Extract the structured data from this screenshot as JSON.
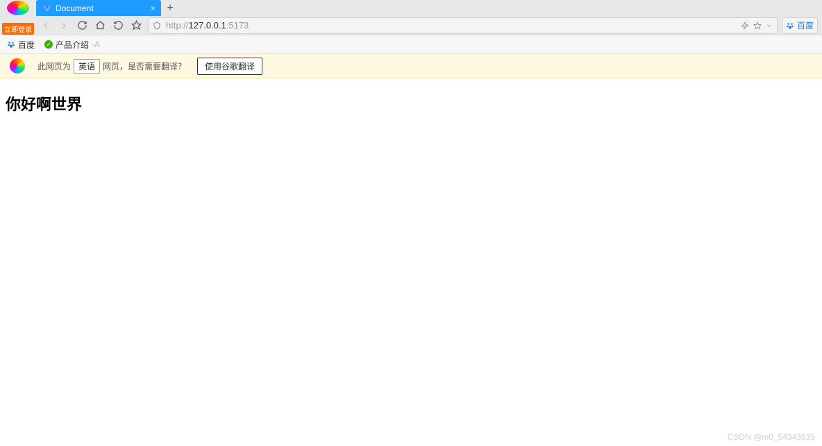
{
  "chrome": {
    "login_button": "立即登录",
    "tab": {
      "title": "Document",
      "close_glyph": "×"
    },
    "new_tab_glyph": "+"
  },
  "address": {
    "scheme": "http://",
    "host": "127.0.0.1",
    "port": ":5173"
  },
  "search_engine": "百度",
  "bookmarks": {
    "baidu": "百度",
    "product_intro": "产品介绍",
    "product_intro_suffix": "-A"
  },
  "translate": {
    "prefix": "此网页为",
    "language": "英语",
    "suffix": "网页，是否需要翻译？",
    "button": "使用谷歌翻译"
  },
  "page": {
    "heading": "你好啊世界"
  },
  "watermark": "CSDN @m0_54343635"
}
